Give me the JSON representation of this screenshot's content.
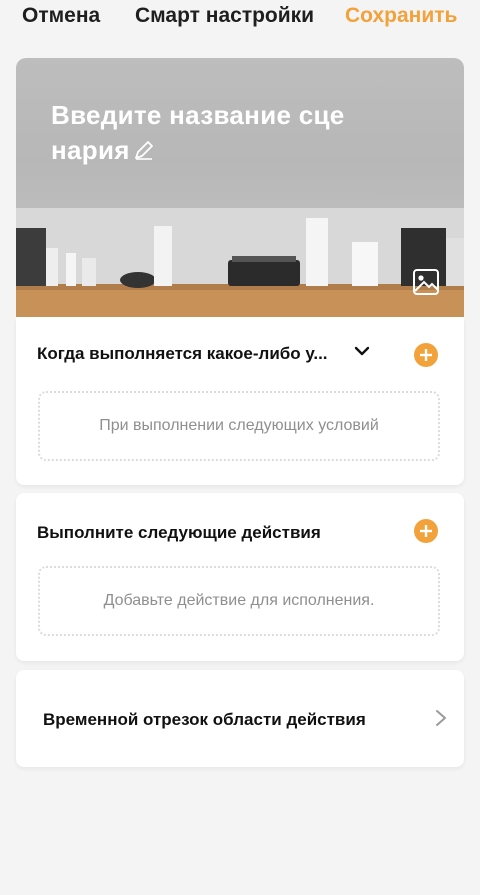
{
  "topbar": {
    "cancel_label": "Отмена",
    "title": "Смарт настройки",
    "save_label": "Сохранить"
  },
  "hero": {
    "scene_title": "Введите название сце нария",
    "edit_icon": "pencil-icon",
    "image_icon": "image-icon"
  },
  "condition": {
    "heading": "Когда выполняется какое-либо у...",
    "placeholder": "При выполнении следующих условий",
    "expand_icon": "chevron-down-icon",
    "add_icon": "plus-icon"
  },
  "actions": {
    "heading": "Выполните следующие действия",
    "placeholder": "Добавьте действие для исполнения.",
    "add_icon": "plus-icon"
  },
  "time_range": {
    "label": "Временной отрезок области действия",
    "icon": "chevron-right-icon"
  },
  "colors": {
    "accent": "#f2a23a",
    "background": "#f4f4f4",
    "card": "#ffffff"
  }
}
